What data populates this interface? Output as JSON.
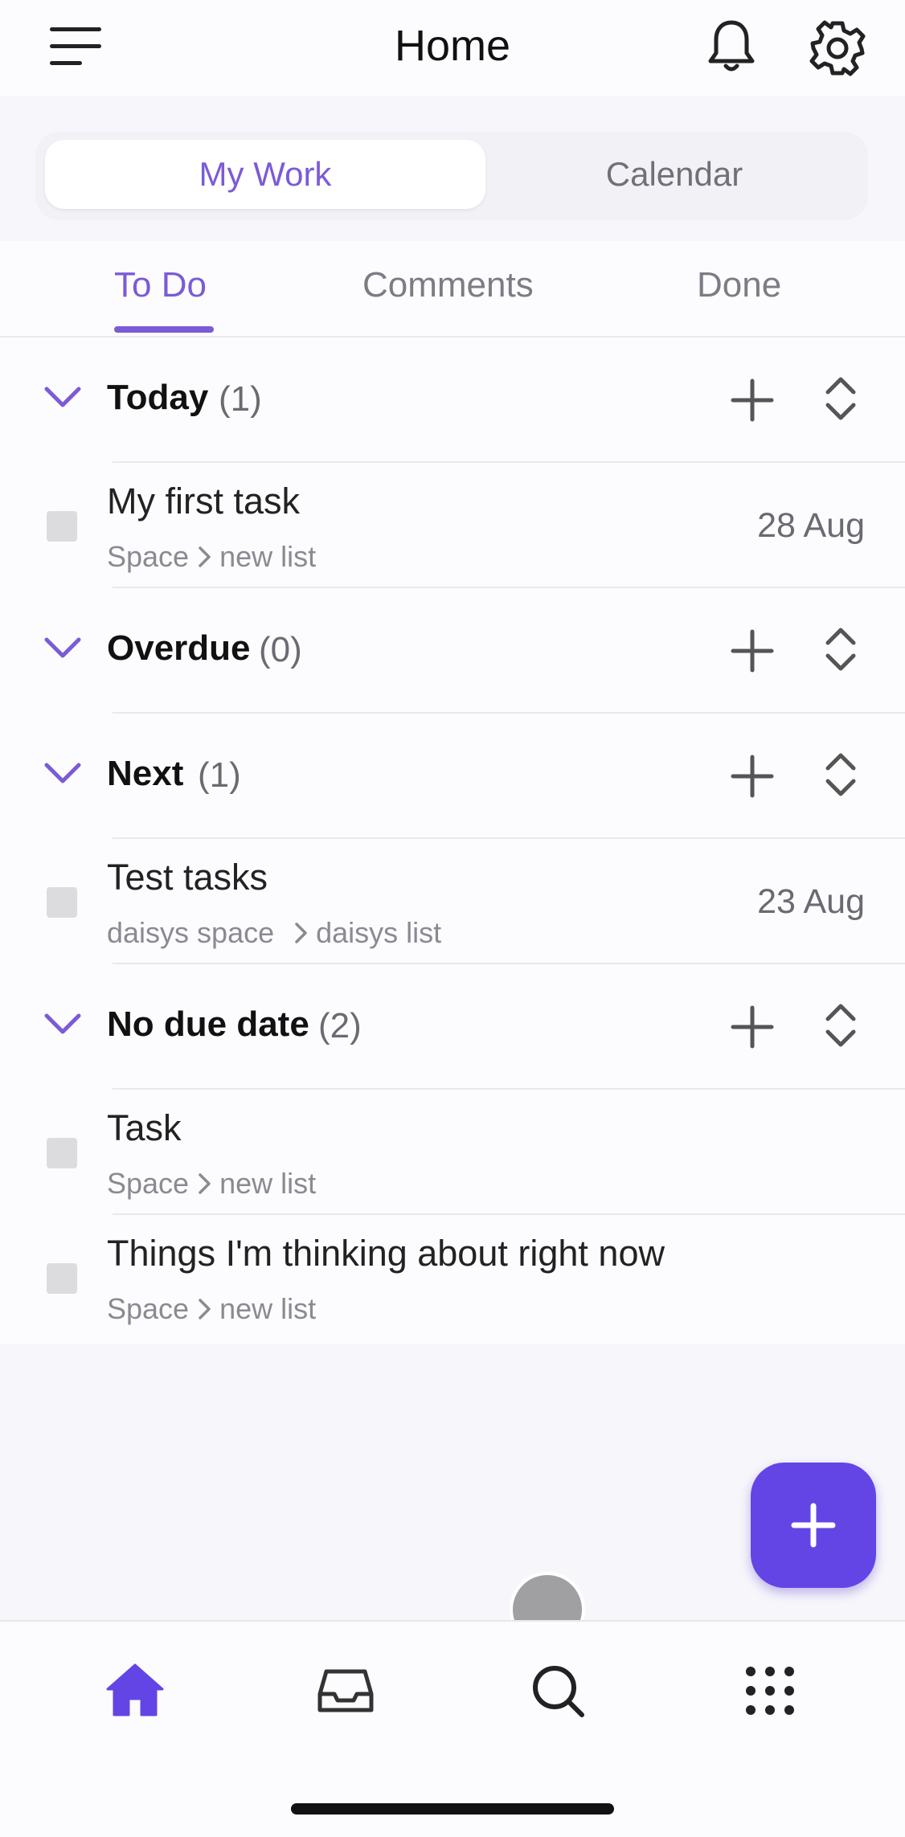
{
  "header": {
    "title": "Home"
  },
  "segments": {
    "active": "My Work",
    "inactive": "Calendar"
  },
  "tabs": [
    {
      "label": "To Do"
    },
    {
      "label": "Comments"
    },
    {
      "label": "Done"
    }
  ],
  "sections": [
    {
      "title": "Today",
      "count": "(1)"
    },
    {
      "title": "Overdue",
      "count": "(0)"
    },
    {
      "title": "Next",
      "count": "(1)"
    },
    {
      "title": "No due date",
      "count": "(2)"
    }
  ],
  "tasks": [
    {
      "name": "My first task",
      "space": "Space",
      "list": "new list",
      "date": "28 Aug"
    },
    {
      "name": "Test tasks",
      "space": "daisys space",
      "list": "daisys list",
      "date": "23 Aug"
    },
    {
      "name": "Task",
      "space": "Space",
      "list": "new list",
      "date": ""
    },
    {
      "name": "Things I'm thinking about right now",
      "space": "Space",
      "list": "new list",
      "date": ""
    }
  ],
  "colors": {
    "accent": "#7b5bd6",
    "fab": "#6345e6",
    "home_icon": "#6345e6"
  },
  "icons": {
    "menu": "menu-icon",
    "bell": "bell-icon",
    "gear": "gear-icon",
    "chevron": "chevron-down-icon",
    "plus": "plus-icon",
    "expand": "expand-collapse-icon",
    "home": "home-icon",
    "inbox": "inbox-icon",
    "search": "search-icon",
    "apps": "apps-grid-icon"
  }
}
